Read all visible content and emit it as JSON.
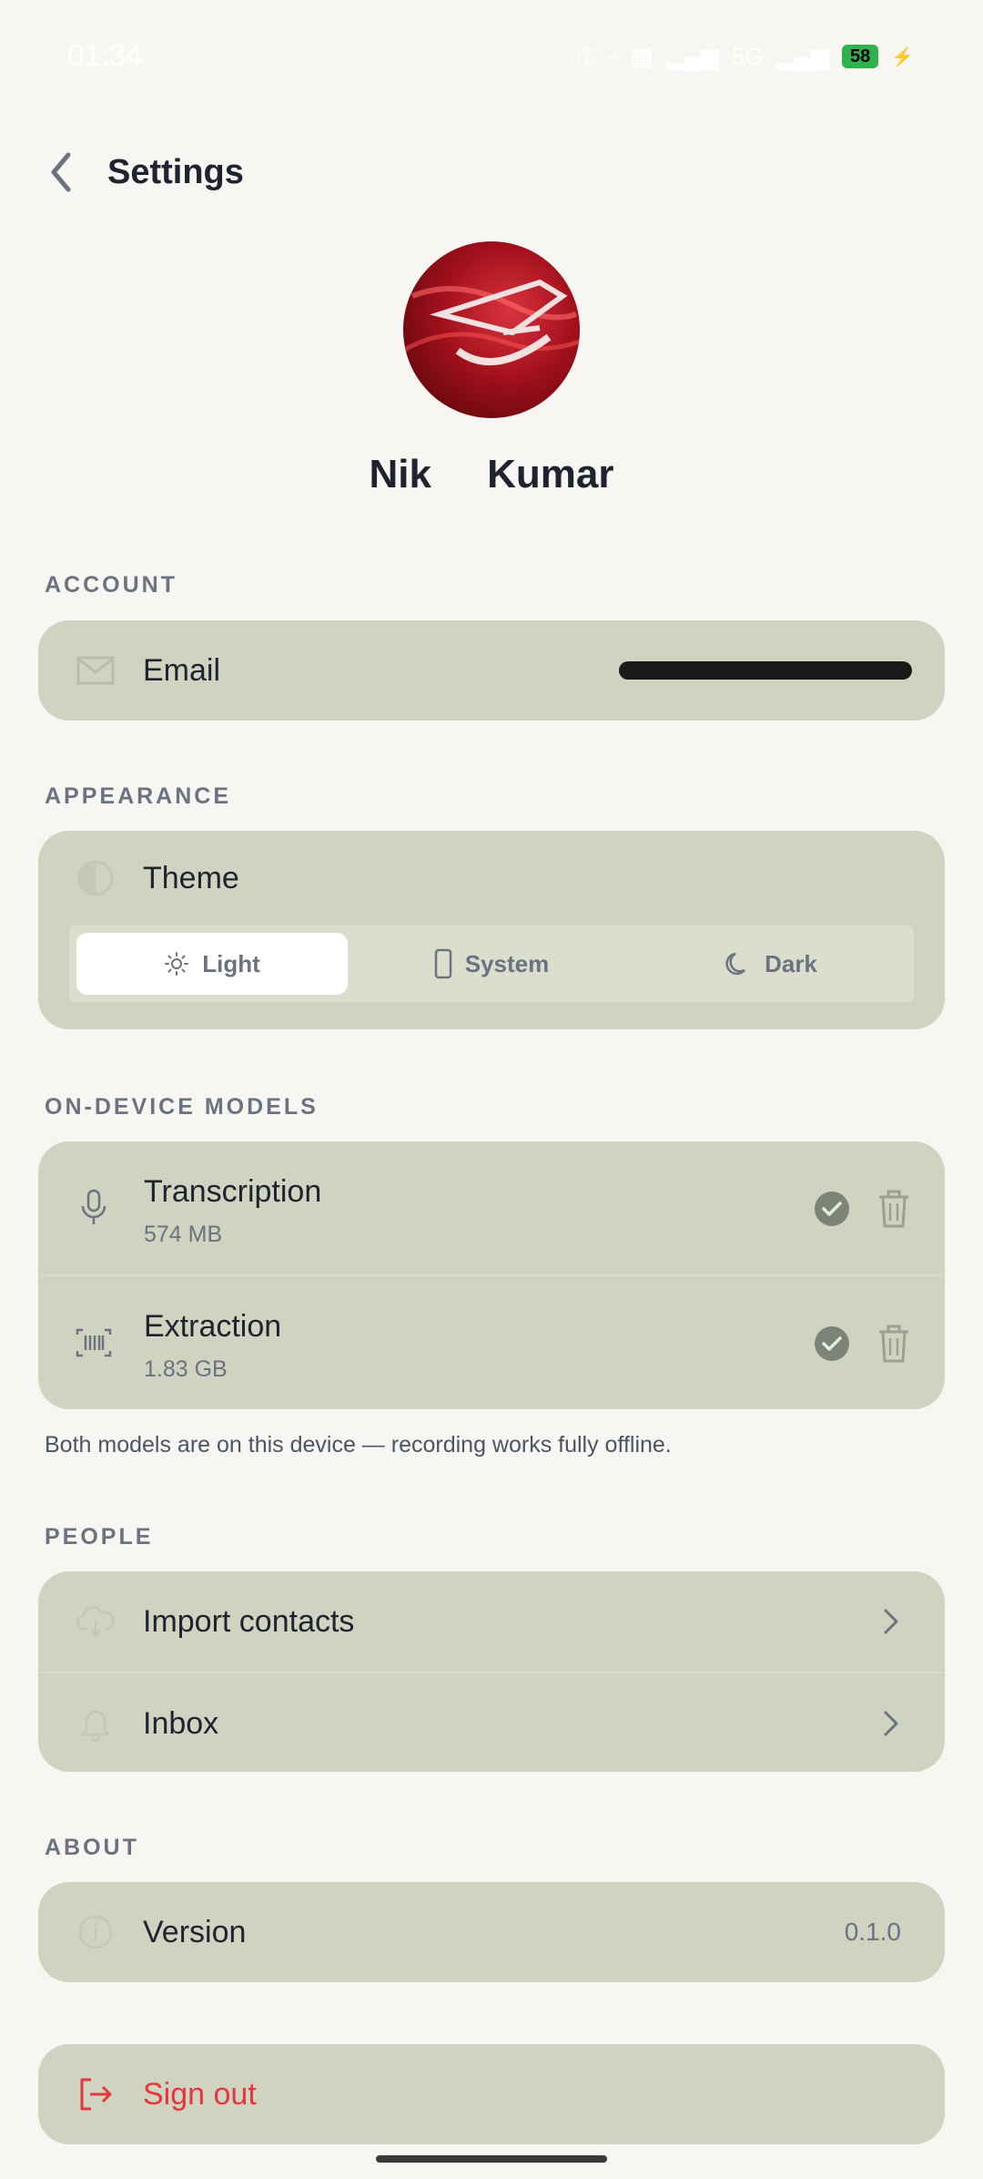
{
  "status_bar": {
    "time": "01:34",
    "network": "5G",
    "battery": "58"
  },
  "header": {
    "title": "Settings"
  },
  "profile": {
    "name": "Nik     Kumar"
  },
  "account": {
    "section_label": "ACCOUNT",
    "email_label": "Email"
  },
  "appearance": {
    "section_label": "APPEARANCE",
    "theme_label": "Theme",
    "options": [
      {
        "label": "Light",
        "selected": true
      },
      {
        "label": "System",
        "selected": false
      },
      {
        "label": "Dark",
        "selected": false
      }
    ]
  },
  "models": {
    "section_label": "ON-DEVICE MODELS",
    "items": [
      {
        "name": "Transcription",
        "size": "574 MB",
        "icon": "microphone-icon"
      },
      {
        "name": "Extraction",
        "size": "1.83 GB",
        "icon": "barcode-icon"
      }
    ],
    "note": "Both models are on this device — recording works fully offline."
  },
  "people": {
    "section_label": "PEOPLE",
    "items": [
      {
        "label": "Import contacts",
        "icon": "cloud-download-icon"
      },
      {
        "label": "Inbox",
        "icon": "bell-icon"
      }
    ]
  },
  "about": {
    "section_label": "ABOUT",
    "version_label": "Version",
    "version_value": "0.1.0"
  },
  "signout": {
    "label": "Sign out"
  },
  "colors": {
    "background": "#f7f6f2",
    "card": "#cfd3c0",
    "danger": "#e5363d",
    "battery": "#2fb24c"
  }
}
